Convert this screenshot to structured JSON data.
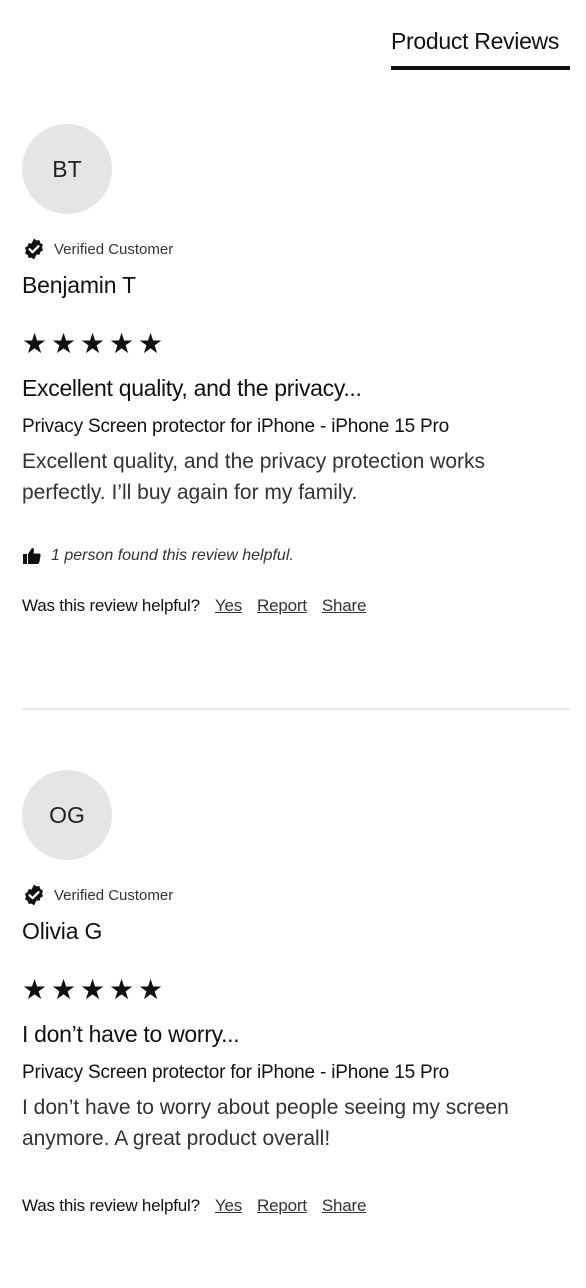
{
  "header": {
    "tab_label": "Product Reviews"
  },
  "reviews": [
    {
      "initials": "BT",
      "verified_label": "Verified Customer",
      "name": "Benjamin T",
      "rating": 5,
      "title": "Excellent quality, and the privacy...",
      "product": "Privacy Screen protector for iPhone - iPhone 15 Pro",
      "body": "Excellent quality, and the privacy protection works perfectly. I’ll buy again for my family.",
      "helpful_count_text": "1 person found this review helpful.",
      "helpful_question": "Was this review helpful?",
      "yes_label": "Yes",
      "report_label": "Report",
      "share_label": "Share"
    },
    {
      "initials": "OG",
      "verified_label": "Verified Customer",
      "name": "Olivia G",
      "rating": 5,
      "title": "I don’t have to worry...",
      "product": "Privacy Screen protector for iPhone - iPhone 15 Pro",
      "body": "I don’t have to worry about people seeing my screen anymore. A great product overall!",
      "helpful_question": "Was this review helpful?",
      "yes_label": "Yes",
      "report_label": "Report",
      "share_label": "Share"
    }
  ],
  "icons": {
    "verified": "verified-badge-icon",
    "thumb": "thumbs-up-icon",
    "star": "star-icon"
  },
  "colors": {
    "text": "#111111",
    "avatar_bg": "#e5e5e5",
    "divider": "#e8e8e8"
  }
}
